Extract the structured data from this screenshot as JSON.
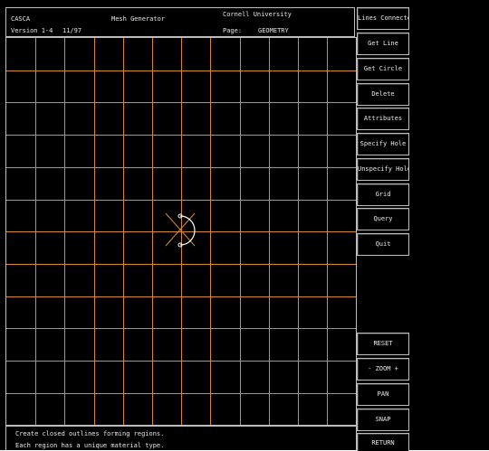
{
  "header": {
    "app_name": "CASCA",
    "version": "Version 1-4",
    "date": "11/97",
    "subtitle": "Mesh Generator",
    "institution": "Cornell University",
    "page_label": "Page:",
    "page_value": "GEOMETRY"
  },
  "menu": {
    "lines_connected": "Lines Connected",
    "get_line": "Get Line",
    "get_circle": "Get Circle",
    "delete": "Delete",
    "attributes": "Attributes",
    "specify_hole": "Specify Hole",
    "unspecify_hole": "Unspecify Hole",
    "grid": "Grid",
    "query": "Query",
    "quit": "Quit",
    "reset": "RESET",
    "zoom": "-  ZOOM  +",
    "pan": "PAN",
    "snap": "SNAP",
    "return": "RETURN"
  },
  "status": {
    "line1": "Create closed outlines forming regions.",
    "line2": "Each region has a unique material type."
  },
  "colors": {
    "grid": "#d98a2e",
    "geometry": "#ffffff",
    "background": "#000000",
    "border": "#bdbdbd"
  }
}
